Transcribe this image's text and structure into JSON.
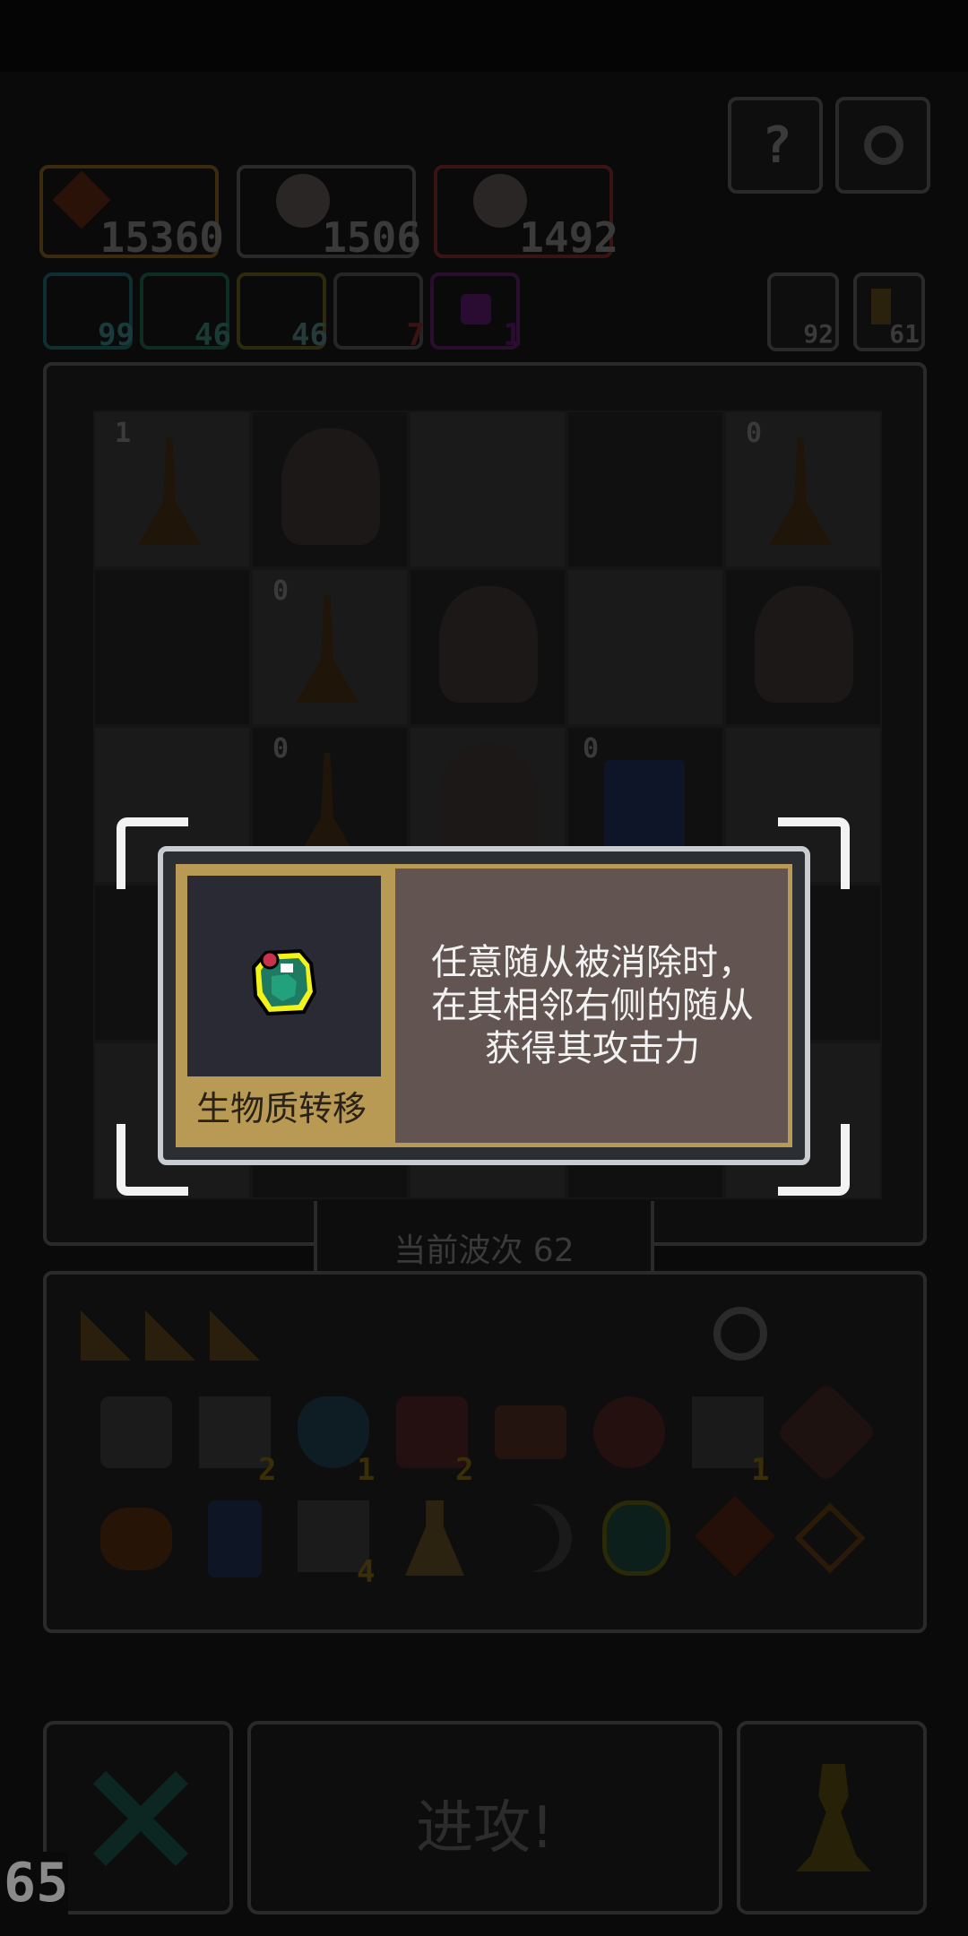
{
  "resources": [
    {
      "icon": "maple-leaf-icon",
      "value": "15360"
    },
    {
      "icon": "character-portrait-icon",
      "value": "1506"
    },
    {
      "icon": "character-portrait-icon",
      "value": "1492"
    }
  ],
  "stats": [
    {
      "icon": "swirl-icon",
      "value": "99"
    },
    {
      "icon": "target-icon",
      "value": "46"
    },
    {
      "icon": "lightning-icon",
      "value": "46"
    },
    {
      "icon": "dark-eye-icon",
      "value": "7"
    },
    {
      "icon": "purple-gem-icon",
      "value": "1"
    }
  ],
  "side_counters": [
    {
      "icon": "arrow-back-icon",
      "value": "92"
    },
    {
      "icon": "key-icon",
      "value": "61"
    }
  ],
  "board_badges": [
    "1",
    "0",
    "0",
    "0",
    "0",
    "0"
  ],
  "wave": {
    "label": "当前波次 62"
  },
  "shelf_badges": [
    "2",
    "1",
    "2",
    "1",
    "4"
  ],
  "tooltip": {
    "item_name": "生物质转移",
    "description": "任意随从被消除时，\n在其相邻右侧的随从\n获得其攻击力"
  },
  "bottom": {
    "attack_label": "进攻!",
    "fps": "65"
  },
  "colors": {
    "card_border": "#b89a55",
    "card_bg": "#625551",
    "selection": "#f2f2f2"
  }
}
